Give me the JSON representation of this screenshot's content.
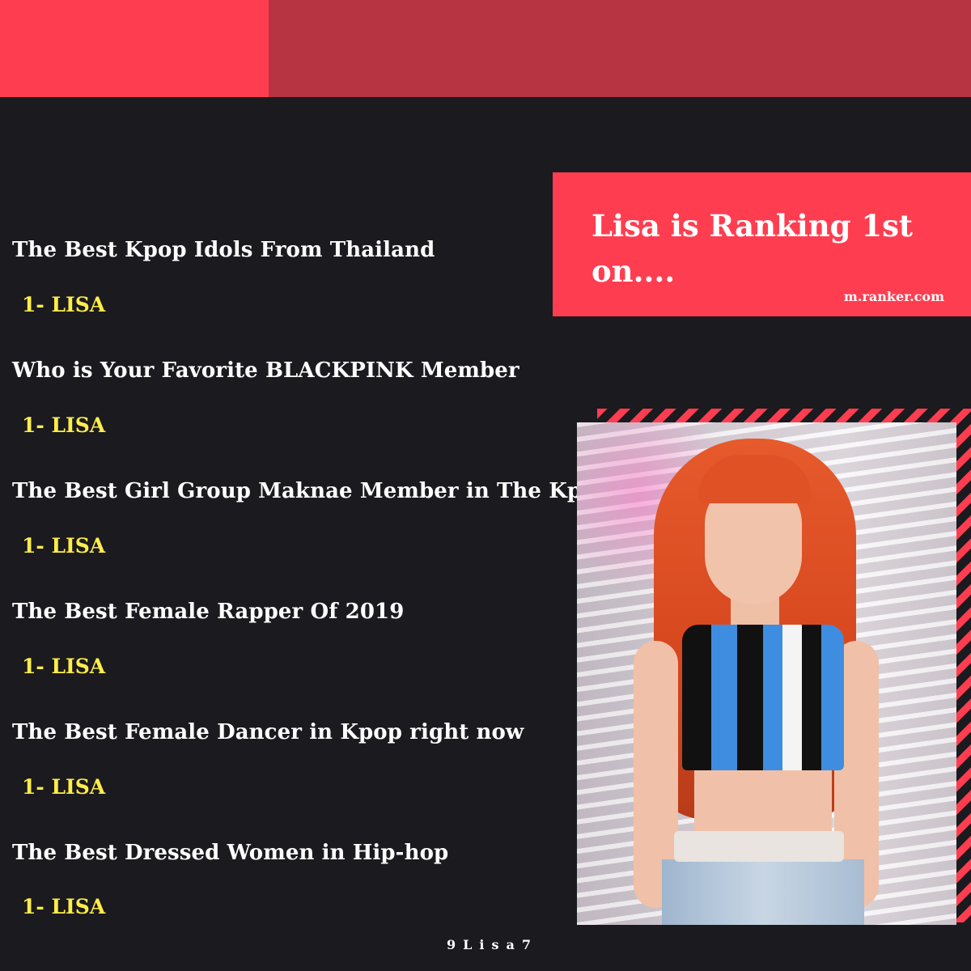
{
  "banner": {
    "title": "Lisa is Ranking 1st on....",
    "source": "m.ranker.com"
  },
  "rankings": [
    {
      "title": "The Best Kpop Idols From Thailand",
      "rank": "1- LISA"
    },
    {
      "title": "Who is Your Favorite BLACKPINK Member",
      "rank": "1- LISA"
    },
    {
      "title": "The Best Girl Group Maknae Member in The Kpop",
      "rank": "1- LISA"
    },
    {
      "title": "The Best Female Rapper Of 2019",
      "rank": "1- LISA"
    },
    {
      "title": "The Best Female Dancer in Kpop right now",
      "rank": "1- LISA"
    },
    {
      "title": "The Best Dressed Women in Hip-hop",
      "rank": "1- LISA"
    }
  ],
  "watermark": "9Lisa7",
  "colors": {
    "background": "#1b1a1f",
    "accent_red": "#ff3d50",
    "accent_dark_red": "#b73442",
    "rank_yellow": "#ffed4a"
  }
}
